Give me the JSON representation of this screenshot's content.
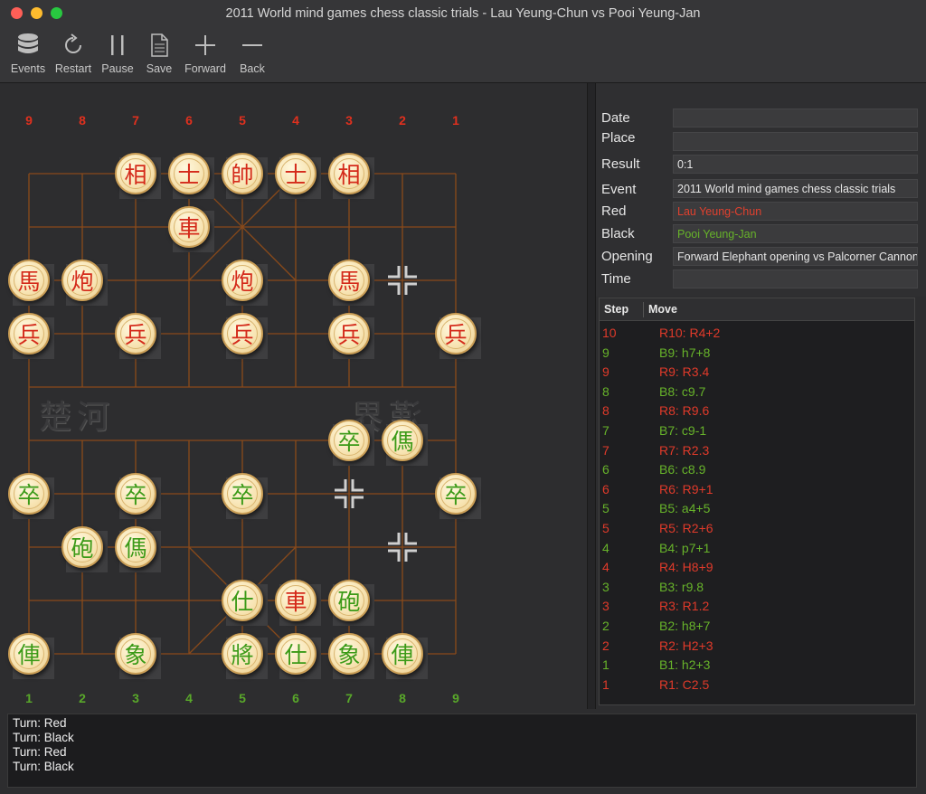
{
  "window": {
    "title": "2011 World mind games chess classic trials - Lau Yeung-Chun vs Pooi Yeung-Jan"
  },
  "toolbar": {
    "events": "Events",
    "restart": "Restart",
    "pause": "Pause",
    "save": "Save",
    "forward": "Forward",
    "back": "Back"
  },
  "board": {
    "top_files": [
      "9",
      "8",
      "7",
      "6",
      "5",
      "4",
      "3",
      "2",
      "1"
    ],
    "bottom_files": [
      "1",
      "2",
      "3",
      "4",
      "5",
      "6",
      "7",
      "8",
      "9"
    ],
    "top_file_color": "#e0301e",
    "bottom_file_color": "#59a82a",
    "line_color": "#8a4a1a",
    "river_left": "楚河",
    "river_right": "漢界",
    "pieces": [
      {
        "char": "相",
        "side": "red"
      },
      {
        "char": "士",
        "side": "red"
      },
      {
        "char": "帥",
        "side": "red"
      },
      {
        "char": "士",
        "side": "red"
      },
      {
        "char": "相",
        "side": "red"
      },
      {
        "char": "車",
        "side": "red"
      },
      {
        "char": "馬",
        "side": "red"
      },
      {
        "char": "炮",
        "side": "red"
      },
      {
        "char": "炮",
        "side": "red"
      },
      {
        "char": "馬",
        "side": "red"
      },
      {
        "char": "兵",
        "side": "red"
      },
      {
        "char": "兵",
        "side": "red"
      },
      {
        "char": "兵",
        "side": "red"
      },
      {
        "char": "兵",
        "side": "red"
      },
      {
        "char": "兵",
        "side": "red"
      },
      {
        "char": "卒",
        "side": "black"
      },
      {
        "char": "傌",
        "side": "black"
      },
      {
        "char": "卒",
        "side": "black"
      },
      {
        "char": "卒",
        "side": "black"
      },
      {
        "char": "卒",
        "side": "black"
      },
      {
        "char": "卒",
        "side": "black"
      },
      {
        "char": "砲",
        "side": "black"
      },
      {
        "char": "傌",
        "side": "black"
      },
      {
        "char": "仕",
        "side": "black"
      },
      {
        "char": "車",
        "side": "red"
      },
      {
        "char": "砲",
        "side": "black"
      },
      {
        "char": "俥",
        "side": "black"
      },
      {
        "char": "象",
        "side": "black"
      },
      {
        "char": "將",
        "side": "black"
      },
      {
        "char": "仕",
        "side": "black"
      },
      {
        "char": "象",
        "side": "black"
      },
      {
        "char": "俥",
        "side": "black"
      }
    ]
  },
  "info": {
    "date": {
      "label": "Date",
      "value": ""
    },
    "place": {
      "label": "Place",
      "value": ""
    },
    "result": {
      "label": "Result",
      "value": "0:1"
    },
    "event": {
      "label": "Event",
      "value": "2011 World mind games chess classic trials"
    },
    "red": {
      "label": "Red",
      "value": "Lau Yeung-Chun"
    },
    "black": {
      "label": "Black",
      "value": "Pooi Yeung-Jan"
    },
    "opening": {
      "label": "Opening",
      "value": "Forward Elephant opening vs Palcorner Cannon"
    },
    "time": {
      "label": "Time",
      "value": ""
    }
  },
  "moves": {
    "header_step": "Step",
    "header_move": "Move",
    "rows": [
      {
        "step": "10",
        "move": "R10: R4+2",
        "side": "red"
      },
      {
        "step": "9",
        "move": "B9: h7+8",
        "side": "black"
      },
      {
        "step": "9",
        "move": "R9: R3.4",
        "side": "red"
      },
      {
        "step": "8",
        "move": "B8: c9.7",
        "side": "black"
      },
      {
        "step": "8",
        "move": "R8: R9.6",
        "side": "red"
      },
      {
        "step": "7",
        "move": "B7: c9-1",
        "side": "black"
      },
      {
        "step": "7",
        "move": "R7: R2.3",
        "side": "red"
      },
      {
        "step": "6",
        "move": "B6: c8.9",
        "side": "black"
      },
      {
        "step": "6",
        "move": "R6: R9+1",
        "side": "red"
      },
      {
        "step": "5",
        "move": "B5: a4+5",
        "side": "black"
      },
      {
        "step": "5",
        "move": "R5: R2+6",
        "side": "red"
      },
      {
        "step": "4",
        "move": "B4: p7+1",
        "side": "black"
      },
      {
        "step": "4",
        "move": "R4: H8+9",
        "side": "red"
      },
      {
        "step": "3",
        "move": "B3: r9.8",
        "side": "black"
      },
      {
        "step": "3",
        "move": "R3: R1.2",
        "side": "red"
      },
      {
        "step": "2",
        "move": "B2: h8+7",
        "side": "black"
      },
      {
        "step": "2",
        "move": "R2: H2+3",
        "side": "red"
      },
      {
        "step": "1",
        "move": "B1: h2+3",
        "side": "black"
      },
      {
        "step": "1",
        "move": "R1: C2.5",
        "side": "red"
      }
    ]
  },
  "log": {
    "lines": [
      "Turn: Red",
      "Turn: Black",
      "Turn: Red",
      "Turn: Black"
    ]
  }
}
